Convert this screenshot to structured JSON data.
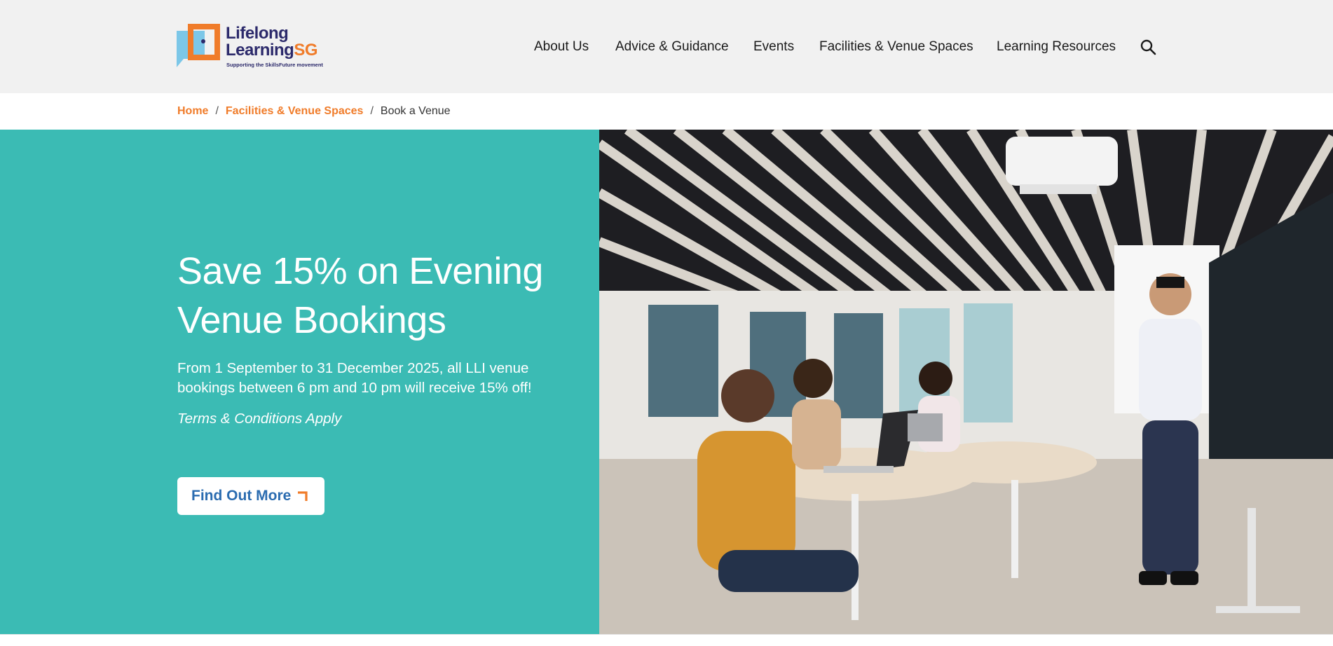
{
  "brand": {
    "line1": "Lifelong",
    "line2": "Learning",
    "line2_accent": "SG",
    "tagline": "Supporting the SkillsFuture movement",
    "colors": {
      "navy": "#2c2a6b",
      "orange": "#f07c2a",
      "sky": "#7cc7e8",
      "teal": "#3bbbb4",
      "link_blue": "#2b6cb0"
    }
  },
  "nav": {
    "items": [
      {
        "label": "About Us"
      },
      {
        "label": "Advice & Guidance"
      },
      {
        "label": "Events"
      },
      {
        "label": "Facilities & Venue Spaces"
      },
      {
        "label": "Learning Resources"
      }
    ],
    "search_icon": "search-icon"
  },
  "breadcrumb": {
    "home": "Home",
    "section": "Facilities & Venue Spaces",
    "current": "Book a Venue",
    "separator": "/"
  },
  "hero": {
    "title": "Save 15% on Evening Venue Bookings",
    "description": "From 1 September to 31 December 2025, all LLI venue bookings between 6 pm and 10 pm will receive 15% off!",
    "terms": "Terms & Conditions Apply",
    "cta_label": "Find Out More",
    "cta_icon": "corner-arrow-icon",
    "image_alt_icon": "venue-photo"
  }
}
